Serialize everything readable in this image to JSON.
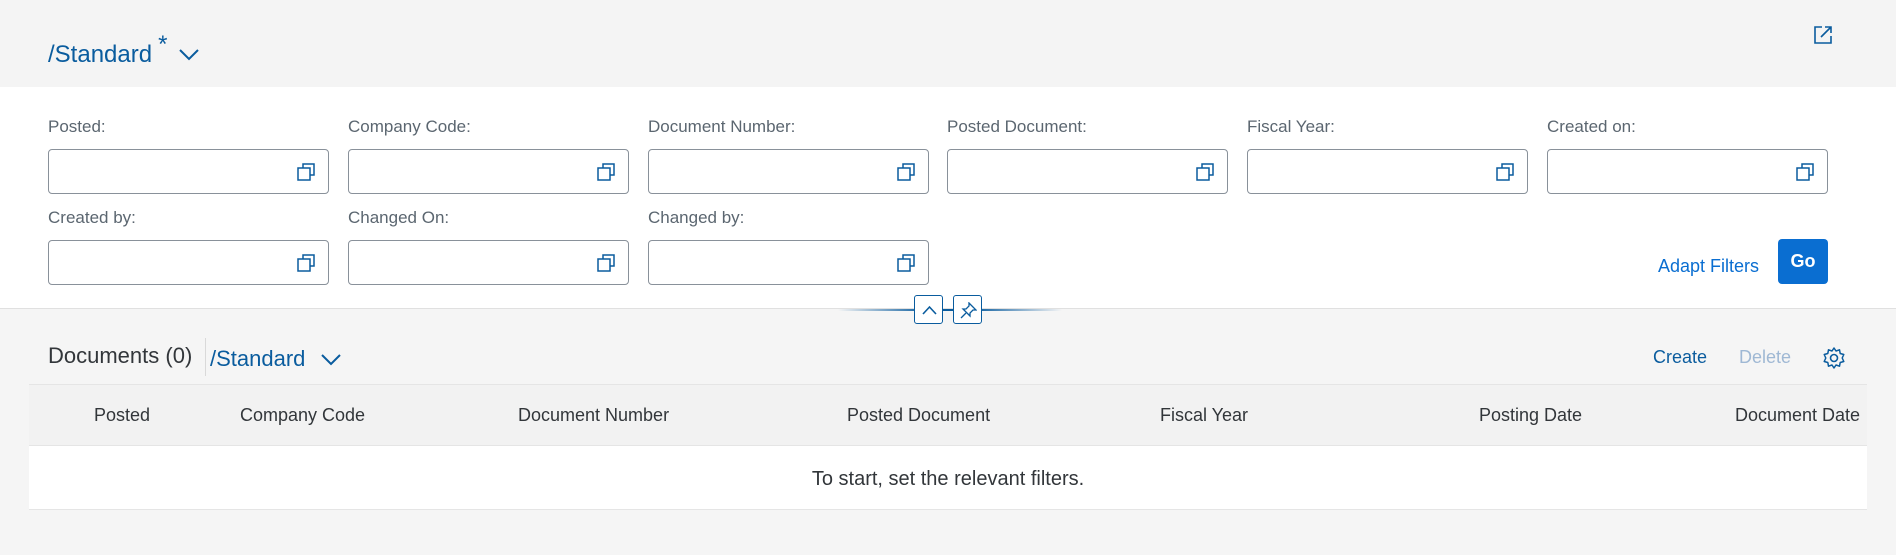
{
  "header": {
    "variant_name": "/Standard",
    "modified_marker": "*",
    "share_icon": "share-icon"
  },
  "filters": [
    {
      "label": "Posted:",
      "value": ""
    },
    {
      "label": "Company Code:",
      "value": ""
    },
    {
      "label": "Document Number:",
      "value": ""
    },
    {
      "label": "Posted Document:",
      "value": ""
    },
    {
      "label": "Fiscal Year:",
      "value": ""
    },
    {
      "label": "Created on:",
      "value": ""
    },
    {
      "label": "Created by:",
      "value": ""
    },
    {
      "label": "Changed On:",
      "value": ""
    },
    {
      "label": "Changed by:",
      "value": ""
    }
  ],
  "filterbar": {
    "adapt_filters_label": "Adapt Filters",
    "go_label": "Go"
  },
  "documents": {
    "title": "Documents (0)",
    "variant_name": "/Standard",
    "create_label": "Create",
    "delete_label": "Delete",
    "columns": [
      "Posted",
      "Company Code",
      "Document Number",
      "Posted Document",
      "Fiscal Year",
      "Posting Date",
      "Document Date"
    ],
    "empty_text": "To start, set the relevant filters."
  },
  "colors": {
    "accent": "#0a6ed1",
    "link": "#0a5c9e",
    "disabled": "#9fb8d4"
  }
}
